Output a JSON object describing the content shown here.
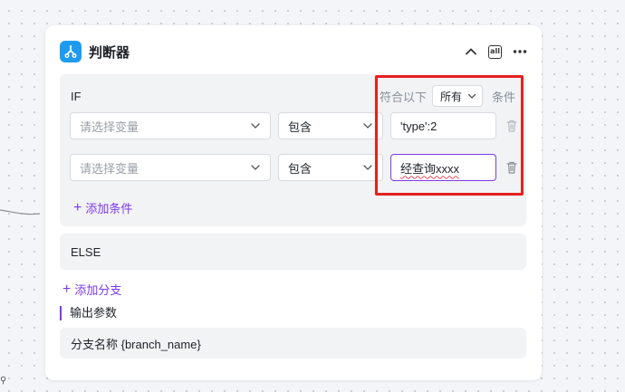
{
  "node": {
    "title": "判断器",
    "icon": "branch-icon",
    "accent": "#1e9bf0"
  },
  "header_actions": {
    "collapse_icon": "chevron-up-icon",
    "all_badge": "all",
    "more_icon": "more-horizontal-icon"
  },
  "if_block": {
    "label": "IF",
    "match_prefix": "符合以下",
    "match_value": "所有",
    "match_suffix": "条件",
    "conditions": [
      {
        "variable_placeholder": "请选择变量",
        "operator": "包含",
        "value": "'type':2"
      },
      {
        "variable_placeholder": "请选择变量",
        "operator": "包含",
        "value": "经查询xxxx"
      }
    ],
    "add_condition_label": "添加条件"
  },
  "else_block": {
    "label": "ELSE"
  },
  "add_branch_label": "添加分支",
  "output": {
    "title": "输出参数",
    "row": "分支名称 {branch_name}"
  },
  "colors": {
    "primary": "#7c3aed",
    "highlight_box": "#e62020",
    "panel_bg": "#f2f3f5"
  }
}
